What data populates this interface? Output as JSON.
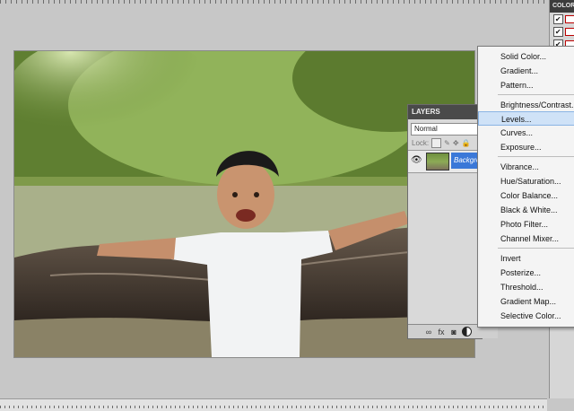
{
  "layers_panel": {
    "tab": "LAYERS",
    "blend_mode": "Normal",
    "lock_label": "Lock:",
    "layer_name": "Background",
    "footer_fx": "fx"
  },
  "right_strip": {
    "header": "COLOR"
  },
  "adjustment_menu": {
    "items": [
      "Solid Color...",
      "Gradient...",
      "Pattern...",
      "Brightness/Contrast...",
      "Levels...",
      "Curves...",
      "Exposure...",
      "Vibrance...",
      "Hue/Saturation...",
      "Color Balance...",
      "Black & White...",
      "Photo Filter...",
      "Channel Mixer...",
      "Invert",
      "Posterize...",
      "Threshold...",
      "Gradient Map...",
      "Selective Color..."
    ],
    "highlighted": "Levels..."
  },
  "colors": {
    "selection_blue": "#3a78d8",
    "menu_highlight": "#cfe2f7",
    "canvas_bg": "#c7c7c7"
  }
}
